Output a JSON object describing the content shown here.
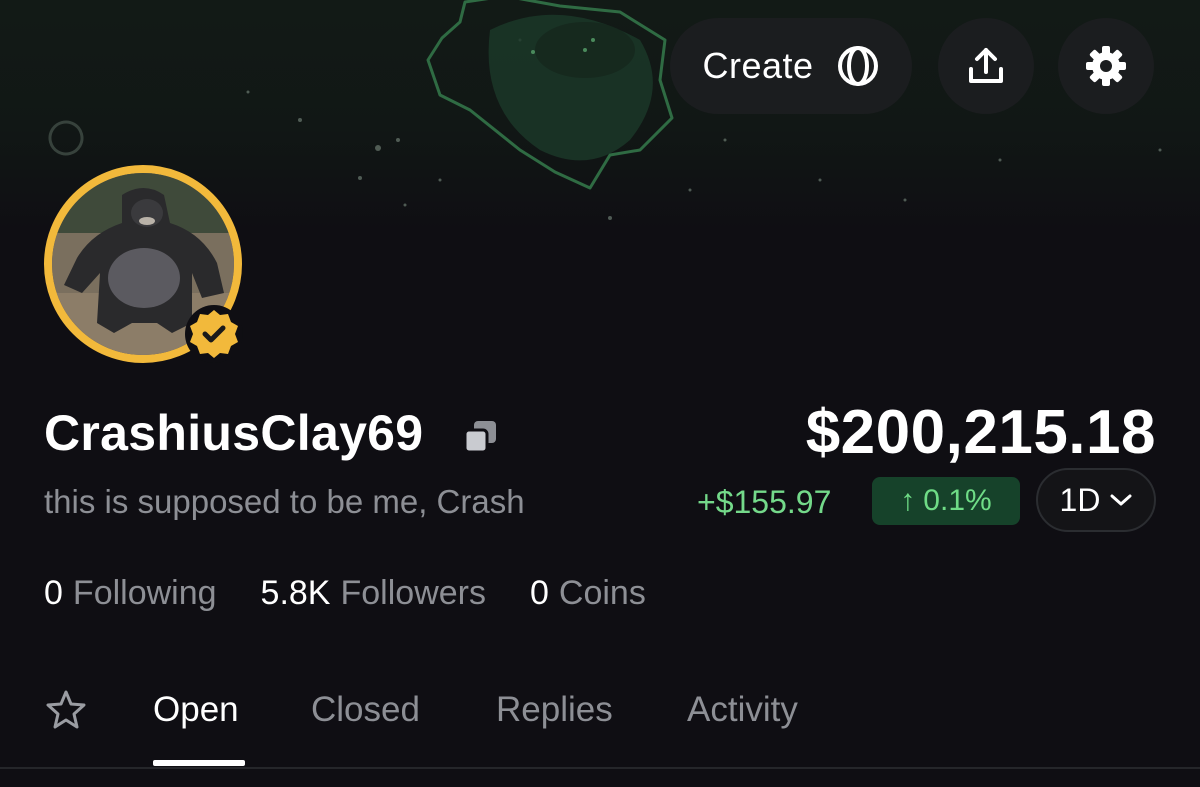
{
  "header": {
    "create_label": "Create",
    "create_icon": "ring-coin-icon",
    "share_icon": "share-upload-icon",
    "settings_icon": "gear-icon"
  },
  "profile": {
    "username": "CrashiusClay69",
    "bio": "this is supposed to be me, Crash",
    "avatar_desc": "gorilla-avatar",
    "verified_color": "#f2b93b"
  },
  "portfolio": {
    "balance": "$200,215.18",
    "change": "+$155.97",
    "change_pct": "0.1%",
    "change_arrow": "↑",
    "range": "1D",
    "positive_color": "#74d98a"
  },
  "stats": {
    "following_count": "0",
    "following_label": "Following",
    "followers_count": "5.8K",
    "followers_label": "Followers",
    "coins_count": "0",
    "coins_label": "Coins"
  },
  "tabs": [
    {
      "label": "Open",
      "active": true
    },
    {
      "label": "Closed",
      "active": false
    },
    {
      "label": "Replies",
      "active": false
    },
    {
      "label": "Activity",
      "active": false
    }
  ]
}
